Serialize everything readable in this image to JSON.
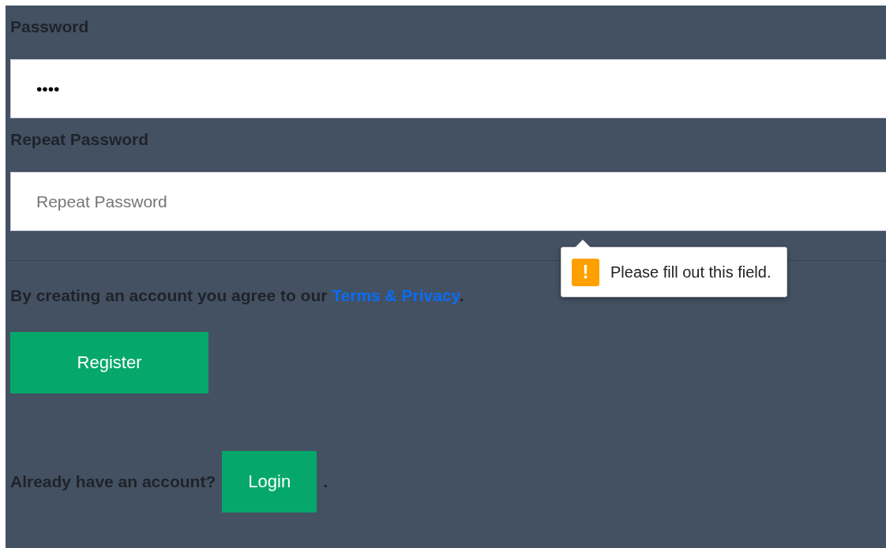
{
  "fields": [
    {
      "label": "Password",
      "value": "••••"
    },
    {
      "label": "Repeat Password",
      "placeholder": "Repeat Password"
    }
  ],
  "tooltip": {
    "message": "Please fill out this field.",
    "icon_text": "!"
  },
  "agreement": {
    "text": "By creating an account you agree to our ",
    "link": "Terms & Privacy",
    "after": "."
  },
  "register_button": "Register",
  "login": {
    "text": "Already have an account?",
    "button": "Login",
    "after": "."
  }
}
